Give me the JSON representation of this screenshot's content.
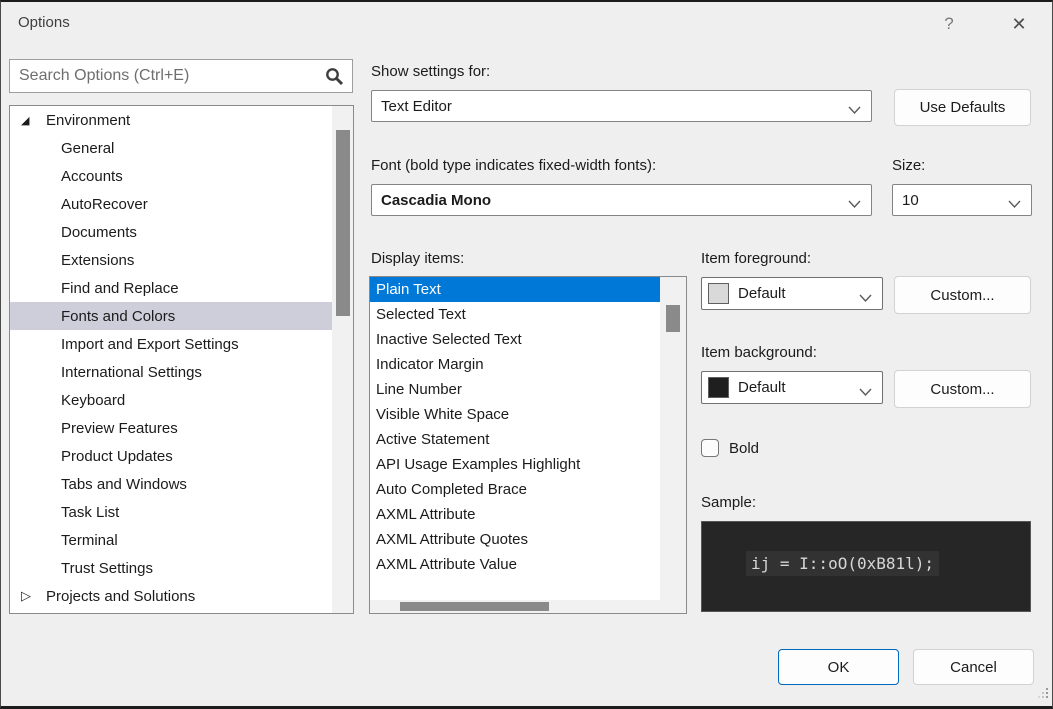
{
  "window": {
    "title": "Options"
  },
  "icons": {
    "help_glyph": "?",
    "close_glyph": "✕",
    "expanded_glyph": "◢",
    "collapsed_glyph": "▷"
  },
  "search": {
    "placeholder": "Search Options (Ctrl+E)"
  },
  "tree": {
    "items": [
      {
        "label": "Environment",
        "level": 0,
        "state": "expanded"
      },
      {
        "label": "General",
        "level": 1
      },
      {
        "label": "Accounts",
        "level": 1
      },
      {
        "label": "AutoRecover",
        "level": 1
      },
      {
        "label": "Documents",
        "level": 1
      },
      {
        "label": "Extensions",
        "level": 1
      },
      {
        "label": "Find and Replace",
        "level": 1
      },
      {
        "label": "Fonts and Colors",
        "level": 1,
        "selected": true
      },
      {
        "label": "Import and Export Settings",
        "level": 1
      },
      {
        "label": "International Settings",
        "level": 1
      },
      {
        "label": "Keyboard",
        "level": 1
      },
      {
        "label": "Preview Features",
        "level": 1
      },
      {
        "label": "Product Updates",
        "level": 1
      },
      {
        "label": "Tabs and Windows",
        "level": 1
      },
      {
        "label": "Task List",
        "level": 1
      },
      {
        "label": "Terminal",
        "level": 1
      },
      {
        "label": "Trust Settings",
        "level": 1
      },
      {
        "label": "Projects and Solutions",
        "level": 0,
        "state": "collapsed"
      }
    ]
  },
  "settings": {
    "show_settings_label": "Show settings for:",
    "show_settings_value": "Text Editor",
    "use_defaults_label": "Use Defaults",
    "font_label": "Font (bold type indicates fixed-width fonts):",
    "font_value": "Cascadia Mono",
    "size_label": "Size:",
    "size_value": "10"
  },
  "display_items": {
    "label": "Display items:",
    "items": [
      {
        "label": "Plain Text",
        "selected": true
      },
      {
        "label": "Selected Text"
      },
      {
        "label": "Inactive Selected Text"
      },
      {
        "label": "Indicator Margin"
      },
      {
        "label": "Line Number"
      },
      {
        "label": "Visible White Space"
      },
      {
        "label": "Active Statement"
      },
      {
        "label": "API Usage Examples Highlight"
      },
      {
        "label": "Auto Completed Brace"
      },
      {
        "label": "AXML Attribute"
      },
      {
        "label": "AXML Attribute Quotes"
      },
      {
        "label": "AXML Attribute Value"
      }
    ]
  },
  "item_colors": {
    "foreground_label": "Item foreground:",
    "foreground_value": "Default",
    "foreground_swatch": "#d9d9d9",
    "background_label": "Item background:",
    "background_value": "Default",
    "background_swatch": "#1f1f1f",
    "custom_label": "Custom..."
  },
  "bold_checkbox": {
    "label": "Bold",
    "checked": false
  },
  "sample": {
    "label": "Sample:",
    "text": "ij = I::oO(0xB81l);"
  },
  "footer": {
    "ok_label": "OK",
    "cancel_label": "Cancel"
  },
  "colors": {
    "list_selection": "#0078d7",
    "tree_selection": "#cdced9",
    "sample_background": "#262626",
    "sample_text": "#d6d6d6",
    "ok_border": "#0067c0"
  }
}
